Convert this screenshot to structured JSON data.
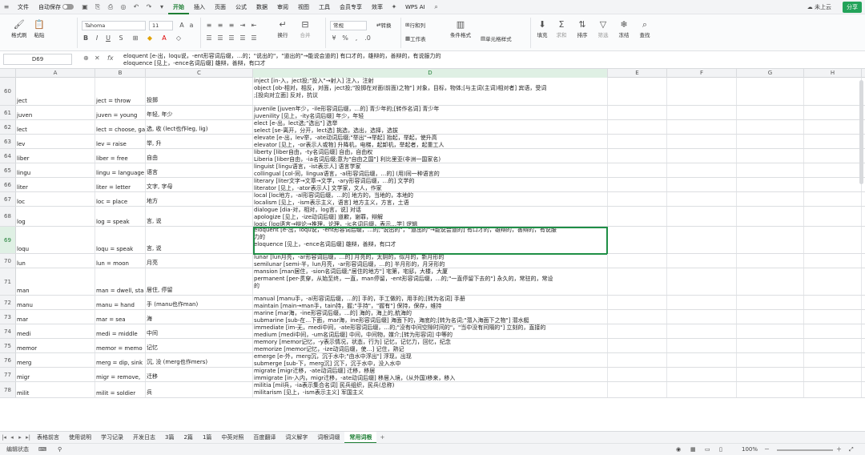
{
  "menubar": {
    "file": "文件",
    "autosave": "自动保存",
    "tabs": [
      "开始",
      "插入",
      "页面",
      "公式",
      "数据",
      "审阅",
      "视图",
      "工具",
      "会员专享",
      "效率"
    ],
    "active_tab": "开始",
    "wps_ai": "WPS AI",
    "cloud": "未上云",
    "share": "分享"
  },
  "ribbon": {
    "format_painter": "格式刷",
    "paste": "粘贴",
    "font_name": "Tahoma",
    "font_size": "11",
    "wrap": "换行",
    "merge": "合并",
    "number_format": "常规",
    "convert": "转换",
    "row_col": "行和列",
    "worksheet": "工作表",
    "cond_format": "条件格式",
    "cell_style": "单元格样式",
    "fill": "填充",
    "sum": "求和",
    "sort": "排序",
    "filter": "筛选",
    "freeze": "冻结",
    "find": "查找"
  },
  "formula_bar": {
    "name_box": "D69",
    "formula": "eloquent [e-出，loqu说，-ent形容词后缀，…的；\"说出的\"，\"道出的\"→能说会道的] 有口才的，雄辩的，善辩的，有说服力的\neloquence [见上，-ence名词后缀] 雄辩，善辩，有口才"
  },
  "columns": [
    "A",
    "B",
    "C",
    "D",
    "E",
    "F",
    "G",
    "H"
  ],
  "selected_column": "D",
  "selected_row": "69",
  "rows": [
    {
      "num": "60",
      "a": "ject",
      "b": "ject = throw",
      "c": "投掷",
      "d": [
        "inject [in-入，ject投;\"投入\"→射入] 注入，注射",
        "object [ob-相对，相反，对面，ject投;\"投掷在对面(前面)之物\"] 对象，目标，物体;[与主词(主词)相对者] 宾语，受词",
        ";[投向对立面] 反对，抗议"
      ]
    },
    {
      "num": "61",
      "a": "juven",
      "b": "juven = young",
      "c": "年轻, 年少",
      "d": [
        "juvenile [juven年少，-ile形容词后缀，…的] 青少年的;[转作名词] 青少年",
        "juvenility [见上，-ity名词后缀] 年少，年轻"
      ]
    },
    {
      "num": "62",
      "a": "lect",
      "b": "lect = choose, ga",
      "c": "选, 收 (lect也作leg, lig)",
      "d": [
        "elect [e-出，lect选;\"选出\"] 选举",
        "select [se-离开，分开，lect选] 挑选，选出，选择，选拔"
      ]
    },
    {
      "num": "63",
      "a": "lev",
      "b": "lev = raise",
      "c": "举, 升",
      "d": [
        "elevate [e-出，lev举，-ate动词后缀;\"举出\"→举起] 抬起，举起，使升高",
        "elevator [见上，-or表示人或物] 升降机，电梯，起卸机，举起者，起重工人"
      ]
    },
    {
      "num": "64",
      "a": "liber",
      "b": "liber = free",
      "c": "自由",
      "d": [
        "liberty [liber自由，-ty名词后缀] 自由，自由权",
        "Liberia [liber自由，-ia名词后缀;意为\"自由之国\"] 利比里亚(非洲一国家名)"
      ]
    },
    {
      "num": "65",
      "a": "lingu",
      "b": "lingu = language",
      "c": "语言",
      "d": [
        "linguist [lingu语言，-ist表示人] 语言学家",
        "collingual [col-同，lingua语言，-al形容词后缀，…的] (用)同一种语言的"
      ]
    },
    {
      "num": "66",
      "a": "liter",
      "b": "liter = letter",
      "c": "文字, 字母",
      "d": [
        "literary [liter文字→文章→文学，-ary形容词后缀，…的] 文学的",
        "literator [见上，-ator表示人] 文学家，文人，作家"
      ]
    },
    {
      "num": "67",
      "a": "loc",
      "b": "loc = place",
      "c": "地方",
      "d": [
        "local [loc地方，-al形容词后缀，…的] 地方的，当地的，本地的",
        "localism [见上，-ism表示主义，语言] 地方主义，方言，土语"
      ]
    },
    {
      "num": "68",
      "a": "log",
      "b": "log = speak",
      "c": "言, 说",
      "d": [
        "dialogue [dia-对，相对，log言，说] 对话",
        "apologize [见上，-ize动词后缀] 道歉，谢罪，辩解",
        "logic [log语言→辩论→推理，论理，-ic名词后缀，表示…学] 逻辑"
      ]
    },
    {
      "num": "69",
      "a": "loqu",
      "b": "loqu = speak",
      "c": "言, 说",
      "d": [
        "eloquent [e-出，loqu说，-ent形容词后缀，…的;\"说出的\"，\"道出的\"→能说会道的] 有口才的，雄辩的，善辩的，有说服",
        "力的",
        "eloquence [见上，-ence名词后缀] 雄辩，善辩，有口才"
      ]
    },
    {
      "num": "70",
      "a": "lun",
      "b": "lun = moon",
      "c": "月亮",
      "d": [
        "lunar [lun月亮，-ar形容词后缀，…的] 月亮的，太阴的，似月的，新月形的",
        "semilunar [semi-半，lun月亮，-ar形容词后缀，…的] 半月形的，月牙形的"
      ]
    },
    {
      "num": "71",
      "a": "man",
      "b": "man = dwell, sta",
      "c": "居住, 停留",
      "d": [
        "mansion [man居住，-sion名词后缀;\"居住的地方\"] 宅第，宅邸，大楼，大厦",
        "permanent [per-贯穿，从始至终，一直，man停留，-ent形容词后缀，…的;\"一直停留下去的\"] 永久的，常驻的，常设",
        "的"
      ]
    },
    {
      "num": "72",
      "a": "manu",
      "b": "manu = hand",
      "c": "手 (manu也作man)",
      "d": [
        "manual [manu手，-al形容词后缀，…的] 手的，手工做的，用手的;[转为名词] 手册",
        "maintain [main→man手，tain持，握;\"手持\"，\"握有\"] 保持，保存，维持"
      ]
    },
    {
      "num": "73",
      "a": "mar",
      "b": "mar = sea",
      "c": "海",
      "d": [
        "marine [mar海，-ine形容词后缀，…的] 海的，海上的,航海的",
        "submarine [sub-在…下面，mar海，ine形容词后缀] 海面下的，海底的;[转为名词;\"潜入海面下之物\"] 潜水艇"
      ]
    },
    {
      "num": "74",
      "a": "medi",
      "b": "medi = middle",
      "c": "中间",
      "d": [
        "immediate [im-无，medi中间，-ate形容词后缀，…的;\"没有中间空隙时间的\"，\"当中没有间隔的\"] 立刻的，直接的",
        "medium [medi中间，-um名词后缀] 中间，中间物，媒介;[转为形容词] 中等的"
      ]
    },
    {
      "num": "75",
      "a": "memor",
      "b": "memor = memo",
      "c": "记忆",
      "d": [
        "memory [memor记忆，-y表示情况，状态，行为] 记忆，记忆力，回忆，纪念",
        "memorize [memor记忆，-ize动词后缀，使…] 记住，熟记"
      ]
    },
    {
      "num": "76",
      "a": "merg",
      "b": "merg = dip, sink",
      "c": "沉, 没 (merg也作mers)",
      "d": [
        "emerge [e-外，merg沉，沉于水中;\"由水中浮出\"] 浮现，出现",
        "submerge [sub-下，merg沉] 沉下，沉于水中，没入水中"
      ]
    },
    {
      "num": "77",
      "a": "migr",
      "b": "migr = remove,",
      "c": "迁移",
      "d": [
        "migrate [migr迁移，-ate动词后缀] 迁移，移居",
        "immigrate [in-入内，migr迁移，-ate动词后缀] 移居入境，(从外国)移来，移入"
      ]
    },
    {
      "num": "78",
      "a": "milit",
      "b": "milit = soldier",
      "c": "兵",
      "d": [
        "militia [mil兵，-ia表示集合名词] 民兵组织，民兵(总称)",
        "militarism [见上，-ism表示主义] 军国主义"
      ]
    }
  ],
  "sheet_tabs": [
    "表格前言",
    "使用说明",
    "学习记录",
    "开发日志",
    "3篇",
    "2篇",
    "1篇",
    "中英对照",
    "百度翻译",
    "词义解字",
    "词根词缀",
    "常用词根"
  ],
  "active_sheet": "常用词根",
  "status": {
    "mode": "编辑状态",
    "zoom": "100%"
  }
}
